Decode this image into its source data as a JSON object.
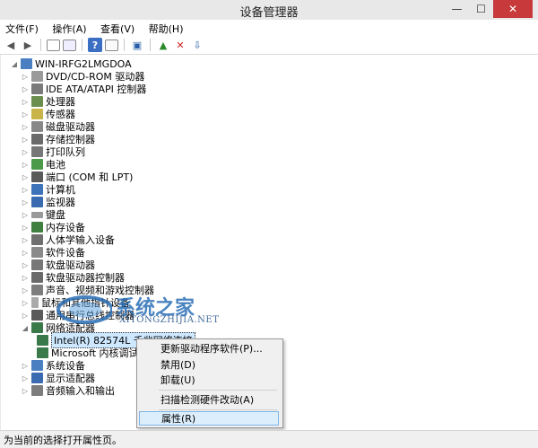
{
  "window": {
    "title": "设备管理器",
    "btn_min": "—",
    "btn_max": "☐",
    "btn_close": "✕"
  },
  "menu": [
    "文件(F)",
    "操作(A)",
    "查看(V)",
    "帮助(H)"
  ],
  "tree": {
    "root": "WIN-IRFG2LMGDOA",
    "categories": [
      "DVD/CD-ROM 驱动器",
      "IDE ATA/ATAPI 控制器",
      "处理器",
      "传感器",
      "磁盘驱动器",
      "存储控制器",
      "打印队列",
      "电池",
      "端口 (COM 和 LPT)",
      "计算机",
      "监视器",
      "键盘",
      "内存设备",
      "人体学输入设备",
      "软件设备",
      "软盘驱动器",
      "软盘驱动器控制器",
      "声音、视频和游戏控制器",
      "鼠标和其他指针设备",
      "通用串行总线控制器",
      "网络适配器"
    ],
    "network_children": [
      "Intel(R) 82574L 千兆网络连接",
      "Microsoft 内核调试"
    ],
    "after": [
      "系统设备",
      "显示适配器",
      "音频输入和输出"
    ]
  },
  "context_menu": {
    "update": "更新驱动程序软件(P)...",
    "disable": "禁用(D)",
    "uninstall": "卸载(U)",
    "scan": "扫描检测硬件改动(A)",
    "properties": "属性(R)"
  },
  "watermark": {
    "brand": "系统之家",
    "site": "XITONGZHIJIA.NET"
  },
  "statusbar": {
    "text": "为当前的选择打开属性页。"
  },
  "colors": {
    "accent": "#2b6fb6",
    "close": "#c7393a",
    "highlight": "#dceefc"
  }
}
